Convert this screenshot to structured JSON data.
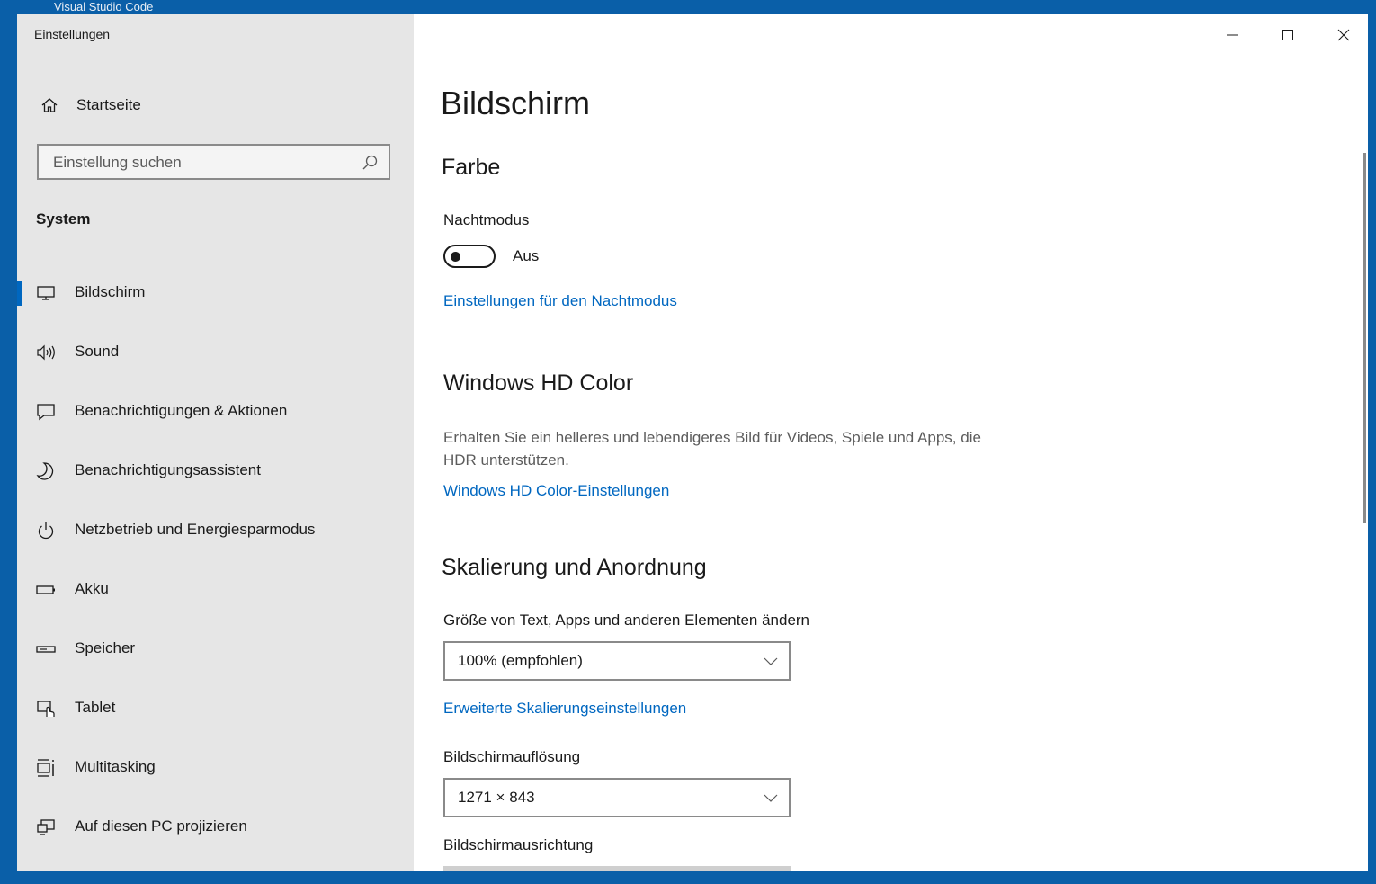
{
  "background": {
    "app_title": "Visual Studio Code"
  },
  "window": {
    "title": "Einstellungen",
    "controls": {
      "minimize": "minimize-icon",
      "maximize": "maximize-icon",
      "close": "close-icon"
    }
  },
  "sidebar": {
    "home_label": "Startseite",
    "search_placeholder": "Einstellung suchen",
    "group_label": "System",
    "items": [
      {
        "label": "Bildschirm",
        "icon": "monitor-icon",
        "active": true
      },
      {
        "label": "Sound",
        "icon": "speaker-icon",
        "active": false
      },
      {
        "label": "Benachrichtigungen & Aktionen",
        "icon": "notification-icon",
        "active": false
      },
      {
        "label": "Benachrichtigungsassistent",
        "icon": "moon-icon",
        "active": false
      },
      {
        "label": "Netzbetrieb und Energiesparmodus",
        "icon": "power-icon",
        "active": false
      },
      {
        "label": "Akku",
        "icon": "battery-icon",
        "active": false
      },
      {
        "label": "Speicher",
        "icon": "storage-icon",
        "active": false
      },
      {
        "label": "Tablet",
        "icon": "tablet-icon",
        "active": false
      },
      {
        "label": "Multitasking",
        "icon": "multitasking-icon",
        "active": false
      },
      {
        "label": "Auf diesen PC projizieren",
        "icon": "project-icon",
        "active": false
      }
    ]
  },
  "main": {
    "page_title": "Bildschirm",
    "color_section": {
      "heading": "Farbe",
      "night_mode_label": "Nachtmodus",
      "night_mode_state": "Aus",
      "night_mode_link": "Einstellungen für den Nachtmodus"
    },
    "hdr_section": {
      "heading": "Windows HD Color",
      "description": "Erhalten Sie ein helleres und lebendigeres Bild für Videos, Spiele und Apps, die HDR unterstützen.",
      "link": "Windows HD Color-Einstellungen"
    },
    "scale_section": {
      "heading": "Skalierung und Anordnung",
      "scale_label": "Größe von Text, Apps und anderen Elementen ändern",
      "scale_value": "100% (empfohlen)",
      "advanced_link": "Erweiterte Skalierungseinstellungen",
      "resolution_label": "Bildschirmauflösung",
      "resolution_value": "1271 × 843",
      "orientation_label": "Bildschirmausrichtung"
    }
  },
  "colors": {
    "accent": "#0067c0",
    "sidebar_bg": "#e6e6e6",
    "desktop_bg": "#0a5fa8"
  }
}
